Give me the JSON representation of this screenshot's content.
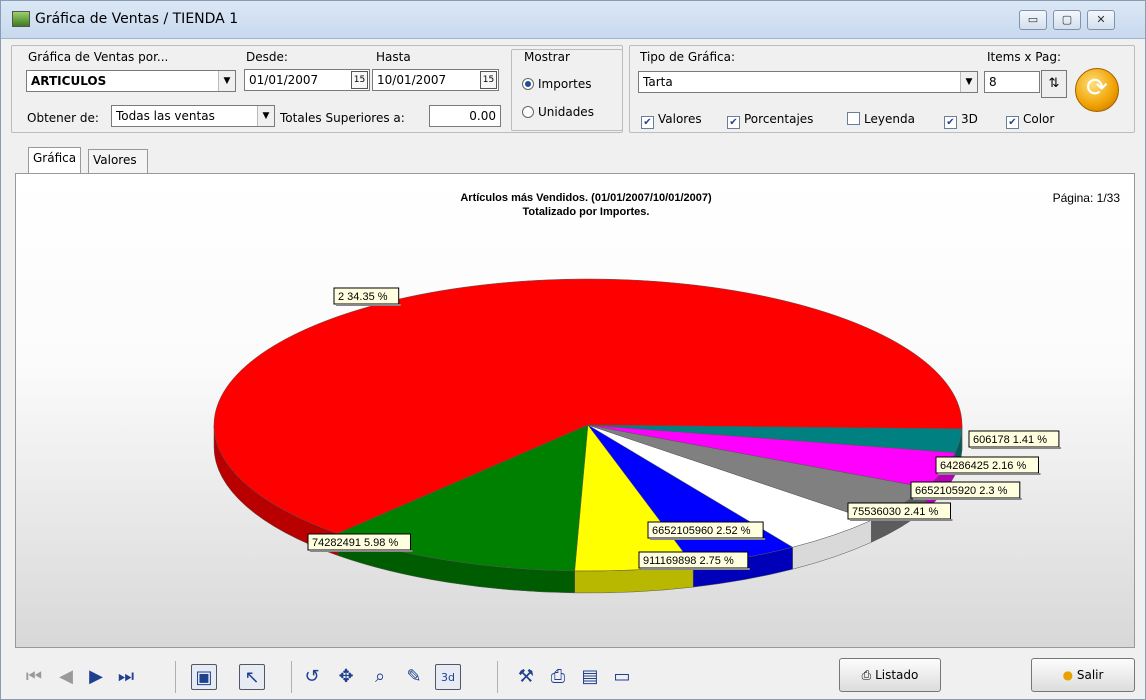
{
  "window": {
    "title": "Gráfica de Ventas / TIENDA 1",
    "min_icon": "minimize-icon",
    "max_icon": "maximize-icon",
    "close_icon": "close-icon"
  },
  "filters": {
    "grafica_por_label": "Gráfica de Ventas por...",
    "grafica_por_value": "ARTICULOS",
    "desde_label": "Desde:",
    "desde_value": "01/01/2007",
    "hasta_label": "Hasta",
    "hasta_value": "10/01/2007",
    "obtener_label": "Obtener de:",
    "obtener_value": "Todas las ventas",
    "totales_label": "Totales Superiores a:",
    "totales_value": "0.00",
    "mostrar_label": "Mostrar",
    "mostrar_options": [
      "Importes",
      "Unidades"
    ],
    "mostrar_selected": "Importes"
  },
  "chart_options": {
    "tipo_label": "Tipo de Gráfica:",
    "tipo_value": "Tarta",
    "items_label": "Items x Pag:",
    "items_value": "8",
    "checks": [
      {
        "label": "Valores",
        "checked": true
      },
      {
        "label": "Porcentajes",
        "checked": true
      },
      {
        "label": "Leyenda",
        "checked": false
      },
      {
        "label": "3D",
        "checked": true
      },
      {
        "label": "Color",
        "checked": true
      }
    ]
  },
  "tabs": [
    "Gráfica",
    "Valores"
  ],
  "active_tab": "Gráfica",
  "chart_data": {
    "type": "pie",
    "title": "Artículos más Vendidos. (01/01/2007/10/01/2007)",
    "subtitle": "Totalizado por Importes.",
    "page_label": "Página: 1/33",
    "three_d": true,
    "slices": [
      {
        "label": "2",
        "percent": 34.35,
        "color": "#ff0000",
        "text": "2 34.35 %"
      },
      {
        "label": "74282491",
        "percent": 5.98,
        "color": "#008000",
        "text": "74282491 5.98 %"
      },
      {
        "label": "911169898",
        "percent": 2.75,
        "color": "#ffff00",
        "text": "911169898 2.75 %"
      },
      {
        "label": "6652105960",
        "percent": 2.52,
        "color": "#0000ff",
        "text": "6652105960 2.52 %"
      },
      {
        "label": "75536030",
        "percent": 2.41,
        "color": "#ffffff",
        "text": "75536030 2.41 %"
      },
      {
        "label": "6652105920",
        "percent": 2.3,
        "color": "#808080",
        "text": "6652105920 2.3 %"
      },
      {
        "label": "64286425",
        "percent": 2.16,
        "color": "#ff00ff",
        "text": "64286425 2.16 %"
      },
      {
        "label": "606178",
        "percent": 1.41,
        "color": "#008080",
        "text": "606178 1.41 %"
      }
    ]
  },
  "buttons": {
    "listado": "Listado",
    "salir": "Salir"
  },
  "toolbar_icons": [
    "first-page-icon",
    "prev-page-icon",
    "next-page-icon",
    "last-page-icon",
    "fit-icon",
    "pointer-icon",
    "rotate-icon",
    "move-icon",
    "zoom-icon",
    "edit-icon",
    "3d-icon",
    "tools-icon",
    "print-icon",
    "export-icon",
    "save-icon"
  ]
}
